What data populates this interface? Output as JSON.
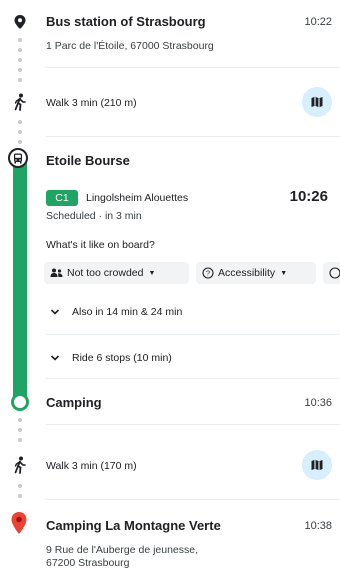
{
  "origin": {
    "name": "Bus station of Strasbourg",
    "address": "1 Parc de l'Étoile, 67000 Strasbourg",
    "time": "10:22"
  },
  "walk1": {
    "label": "Walk 3 min (210 m)"
  },
  "transit": {
    "stop": "Etoile Bourse",
    "line_badge": "C1",
    "line_color": "#1fa463",
    "destination": "Lingolsheim Alouettes",
    "departure": "10:26",
    "status": "Scheduled · in 3 min",
    "onboard_question": "What's it like on board?",
    "chips": [
      "Not too crowded",
      "Accessibility"
    ],
    "also": "Also in 14 min & 24 min",
    "ride": "Ride 6 stops (10 min)"
  },
  "alight": {
    "name": "Camping",
    "time": "10:36"
  },
  "walk2": {
    "label": "Walk 3 min (170 m)"
  },
  "destination": {
    "name": "Camping La Montagne Verte",
    "address_line1": "9 Rue de l'Auberge de jeunesse,",
    "address_line2": "67200 Strasbourg",
    "time": "10:38"
  },
  "colors": {
    "route_green": "#1fa463",
    "map_button_bg": "#d7eefc",
    "destination_pin": "#ea4335"
  },
  "icons": [
    "location-pin-icon",
    "walking-icon",
    "map-icon",
    "bus-icon",
    "people-icon",
    "accessibility-icon",
    "chevron-down-icon"
  ]
}
